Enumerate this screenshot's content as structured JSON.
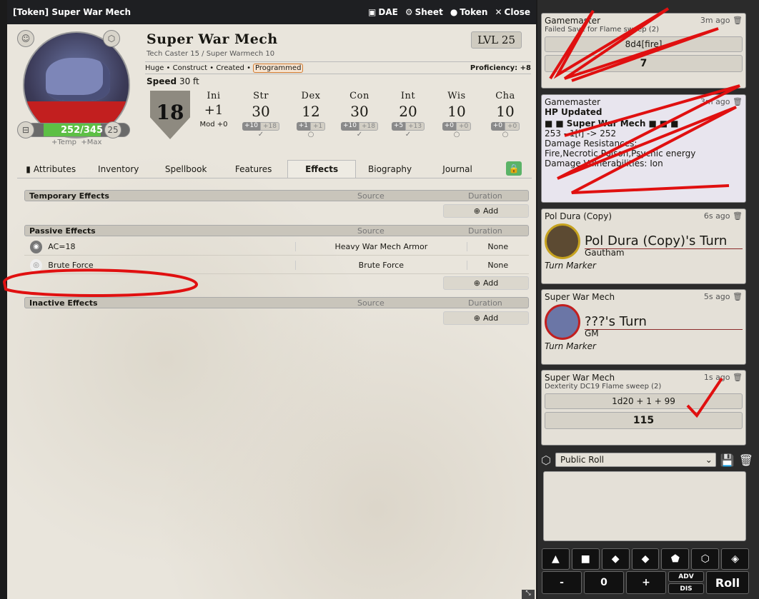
{
  "titlebar": {
    "title": "[Token] Super War Mech",
    "dae": "DAE",
    "sheet": "Sheet",
    "token": "Token",
    "close": "Close"
  },
  "actor": {
    "name": "Super War Mech",
    "classes": "Tech Caster 15 / Super Warmech 10",
    "level": "LVL 25",
    "size": "Huge",
    "type": "Construct",
    "created": "Created",
    "tag": "Programmed",
    "proficiency": "Proficiency: +8",
    "speed_label": "Speed",
    "speed_value": "30 ft",
    "ac": "18",
    "hp": "252/345",
    "temp_label": "+Temp",
    "max_label": "+Max",
    "exhaustion": "0",
    "hd": "25"
  },
  "abilities": [
    {
      "abbr": "Ini",
      "score": "+1",
      "m1": "Mod +0",
      "m2": ""
    },
    {
      "abbr": "Str",
      "score": "30",
      "m1": "+10",
      "m2": "+18",
      "check": "✓"
    },
    {
      "abbr": "Dex",
      "score": "12",
      "m1": "+1",
      "m2": "+1",
      "check": "○"
    },
    {
      "abbr": "Con",
      "score": "30",
      "m1": "+10",
      "m2": "+18",
      "check": "✓"
    },
    {
      "abbr": "Int",
      "score": "20",
      "m1": "+5",
      "m2": "+13",
      "check": "✓"
    },
    {
      "abbr": "Wis",
      "score": "10",
      "m1": "+0",
      "m2": "+0",
      "check": "○"
    },
    {
      "abbr": "Cha",
      "score": "10",
      "m1": "+0",
      "m2": "+0",
      "check": "○"
    }
  ],
  "tabs": [
    "Attributes",
    "Inventory",
    "Spellbook",
    "Features",
    "Effects",
    "Biography",
    "Journal"
  ],
  "effects": {
    "source_label": "Source",
    "duration_label": "Duration",
    "add_label": "Add",
    "temporary": "Temporary Effects",
    "passive": "Passive Effects",
    "inactive": "Inactive Effects",
    "passive_rows": [
      {
        "name": "AC=18",
        "source": "Heavy War Mech Armor",
        "duration": "None"
      },
      {
        "name": "Brute Force",
        "source": "Brute Force",
        "duration": "None"
      }
    ]
  },
  "chat": {
    "c1": {
      "speaker": "Gamemaster",
      "time": "3m ago",
      "flavor": "Failed Save for Flame sweep (2)",
      "formula": "8d4[fire]",
      "total": "7"
    },
    "c2": {
      "speaker": "Gamemaster",
      "time": "3m ago",
      "title": "HP Updated",
      "target": "Super War Mech",
      "line1": "253 - 1[i] -> 252",
      "line2": "Damage Resistances:",
      "line3": "Fire,Necrotic,Poison,Psychic energy",
      "line4": "Damage Vulnerabilities: Ion"
    },
    "c3": {
      "speaker": "Pol Dura (Copy)",
      "time": "6s ago",
      "turn": "Pol Dura (Copy)'s Turn",
      "sub": "Gautham",
      "marker": "Turn Marker"
    },
    "c4": {
      "speaker": "Super War Mech",
      "time": "5s ago",
      "turn": "???'s Turn",
      "sub": "GM",
      "marker": "Turn Marker"
    },
    "c5": {
      "speaker": "Super War Mech",
      "time": "1s ago",
      "flavor": "Dexterity DC19 Flame sweep (2)",
      "formula": "1d20 + 1 + 99",
      "total": "115"
    },
    "rollmode": "Public Roll",
    "controls": {
      "minus": "-",
      "mod": "0",
      "plus": "+",
      "adv": "ADV",
      "dis": "DIS",
      "roll": "Roll"
    }
  }
}
